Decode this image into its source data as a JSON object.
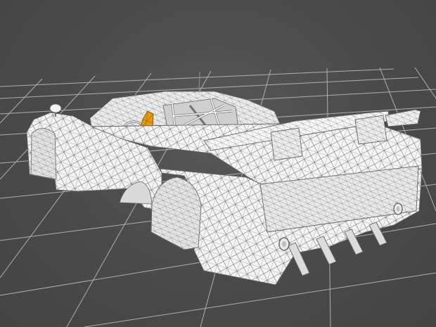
{
  "viewport": {
    "view": "perspective",
    "shading": "wireframe-on-shaded",
    "grid_visible": true,
    "colors": {
      "background": "#4b4b4b",
      "grid": "#c8c8c8",
      "model_fill": "#f4f4f4",
      "model_shadow": "#d6d6d6",
      "wire": "#6a6a6a",
      "selected_part": "#e39b12"
    }
  },
  "model": {
    "type": "race-car-body-mesh",
    "selected_part": "driver-mirror"
  }
}
